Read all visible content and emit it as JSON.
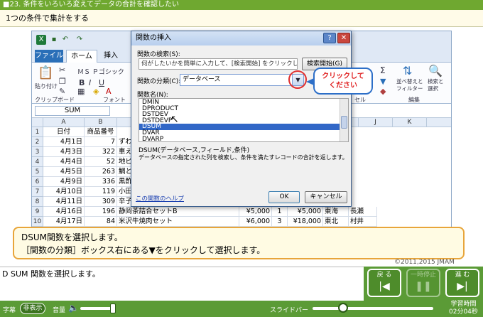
{
  "lesson": {
    "title": "■23. 条件をいろいろ変えてデータの合計を確認したい",
    "subtitle": "1つの条件で集計をする"
  },
  "excel": {
    "tabs": [
      "ファイル",
      "ホーム",
      "挿入"
    ],
    "font_name": "ＭＳ Ｐゴシック",
    "ribbon_labels": {
      "paste": "貼り付け",
      "clipboard": "クリップボード",
      "font": "フォント",
      "cells": "セル",
      "sort_filter": "並べ替えと\nフィルター",
      "find_select": "検索と\n選択",
      "editing": "編集"
    },
    "name_box": "SUM",
    "columns": [
      "A",
      "B",
      "J",
      "K"
    ],
    "rows": [
      {
        "n": "1",
        "a": "日付",
        "b": "商品番号"
      },
      {
        "n": "2",
        "a": "4月1日",
        "b": "7",
        "c": "ずわ"
      },
      {
        "n": "3",
        "a": "4月3日",
        "b": "322",
        "c": "車え"
      },
      {
        "n": "4",
        "a": "4月4日",
        "b": "52",
        "c": "地ビ"
      },
      {
        "n": "5",
        "a": "4月5日",
        "b": "263",
        "c": "鯛と"
      },
      {
        "n": "6",
        "a": "4月9日",
        "b": "336",
        "c": "黒酢"
      },
      {
        "n": "7",
        "a": "4月10日",
        "b": "119",
        "c": "小田"
      },
      {
        "n": "8",
        "a": "4月11日",
        "b": "309",
        "c": "辛子"
      },
      {
        "n": "9",
        "a": "4月16日",
        "b": "196",
        "c": "静岡茶詰合セットB",
        "d": "¥5,000",
        "e": "1",
        "f": "¥5,000",
        "g": "東海",
        "h": "長瀬"
      },
      {
        "n": "10",
        "a": "4月17日",
        "b": "84",
        "c": "米沢牛焼肉セット",
        "d": "¥6,000",
        "e": "3",
        "f": "¥18,000",
        "g": "東北",
        "h": "村井"
      }
    ]
  },
  "dialog": {
    "title": "関数の挿入",
    "help_button": "?",
    "close_button": "✕",
    "search_label": "関数の検索(S):",
    "search_placeholder": "何がしたいかを簡単に入力して、[検索開始] をクリックしてください。",
    "search_button": "検索開始(G)",
    "category_label": "関数の分類(C):",
    "category_value": "データベース",
    "function_list_label": "関数名(N):",
    "functions": [
      "DMIN",
      "DPRODUCT",
      "DSTDEV",
      "DSTDEVP",
      "DSUM",
      "DVAR",
      "DVARP"
    ],
    "selected_function": "DSUM",
    "description_title": "DSUM(データベース,フィールド,条件)",
    "description": "データベースの指定された列を検索し、条件を満たすレコードの合計を返します。",
    "help_link": "この関数のヘルプ",
    "ok_button": "OK",
    "cancel_button": "キャンセル"
  },
  "callout": {
    "text": "クリックして\nください"
  },
  "instruction": {
    "line1": "DSUM関数を選択します。",
    "line2": "［関数の分類］ボックス右にある▼をクリックして選択します。"
  },
  "copyright": "©2011,2015 JMAM",
  "caption_text": "D SUM 関数を選択します。",
  "controls": {
    "back_label": "戻 る",
    "pause_label": "一時停止",
    "next_label": "進 む",
    "subtitle_label": "字幕",
    "subtitle_toggle": "非表示",
    "volume_label": "音量",
    "slider_label": "スライドバー",
    "time_title": "学習時間",
    "time_value": "02分04秒",
    "volume_level": 0.95,
    "slide_position": 0.25
  },
  "colors": {
    "header_green": "#6fa830",
    "accent_blue": "#3167c7",
    "callout_red": "#e02020",
    "instruction_border": "#e8a53a"
  }
}
